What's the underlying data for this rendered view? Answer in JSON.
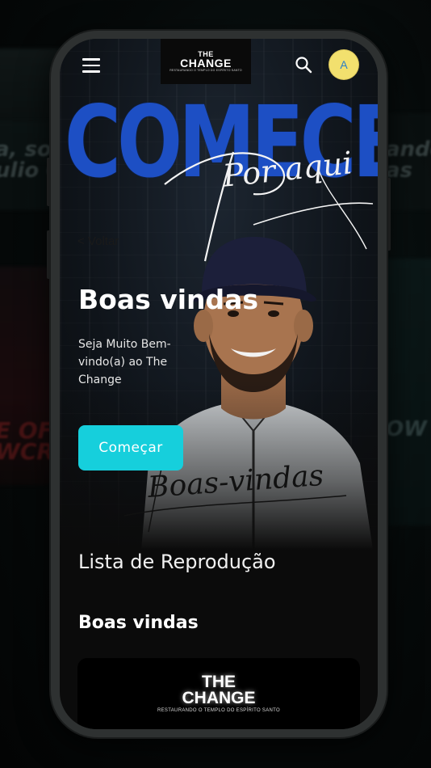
{
  "background": {
    "left_text": "a, sou\nulio Co",
    "right_text": "ando\nas",
    "left_text_2": "E OF\nWCR",
    "right_text_2": "OW"
  },
  "header": {
    "logo_top": "THE",
    "logo_main": "CHANGE",
    "logo_tagline": "RESTAURANDO O TEMPLO DO ESPÍRITO SANTO",
    "avatar_initial": "A"
  },
  "hero": {
    "big_word": "COMECE",
    "script_word": "Por aqui",
    "back_link": "< Voltar",
    "title": "Boas vindas",
    "subtitle": "Seja Muito Bem-vindo(a) ao The Change",
    "cta_label": "Começar",
    "script_footer": "Boas-vindas"
  },
  "main": {
    "playlist_title": "Lista de Reprodução",
    "section_title": "Boas vindas",
    "card": {
      "logo_line_1": "THE",
      "logo_line_2": "CHANGE",
      "logo_tagline": "RESTAURANDO O TEMPLO DO ESPÍRITO SANTO"
    }
  },
  "colors": {
    "accent": "#16cfdc",
    "brand_blue": "#1d4fc4",
    "avatar_bg": "#f2e06e"
  }
}
